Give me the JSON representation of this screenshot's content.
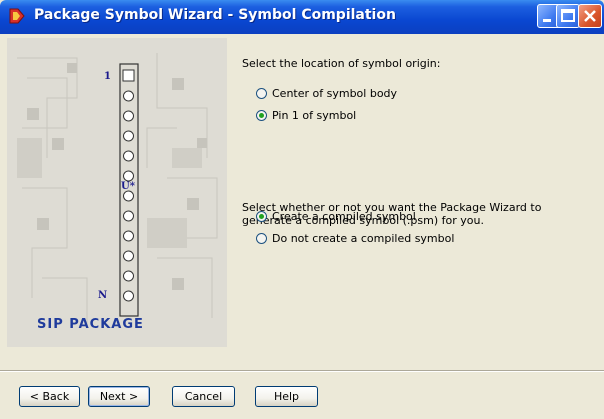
{
  "window": {
    "title": "Package Symbol Wizard - Symbol Compilation"
  },
  "illustration": {
    "pin_one_label": "1",
    "pin_n_label": "N",
    "ref_label": "U*",
    "package_label": "SIP PACKAGE"
  },
  "origin": {
    "prompt": "Select the location of symbol origin:",
    "options": [
      {
        "label": "Center of symbol body",
        "selected": false
      },
      {
        "label": "Pin 1 of symbol",
        "selected": true
      }
    ]
  },
  "compile": {
    "prompt": "Select whether or not you want the Package Wizard to generate a compiled symbol (.psm) for you.",
    "options": [
      {
        "label": "Create a compiled symbol",
        "selected": true
      },
      {
        "label": "Do not create a compiled symbol",
        "selected": false
      }
    ]
  },
  "buttons": {
    "back": "< Back",
    "next": "Next >",
    "cancel": "Cancel",
    "help": "Help"
  },
  "colors": {
    "titlebar": "#0a47d1",
    "radio_selected": "#21a121",
    "label_blue": "#1f3b9c"
  }
}
